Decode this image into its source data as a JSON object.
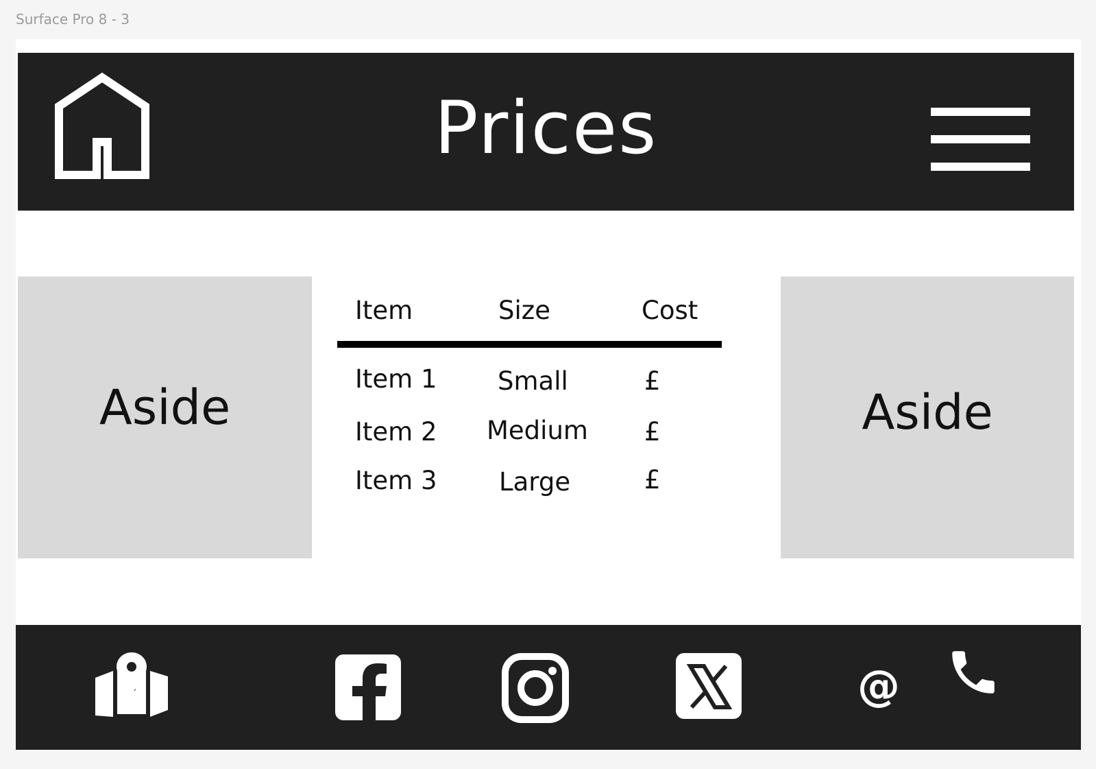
{
  "frame_label": "Surface Pro 8 - 3",
  "colors": {
    "header_bg": "#202020",
    "footer_bg": "#202020",
    "aside_bg": "#d9d9d9",
    "page_bg": "#ffffff",
    "canvas_bg": "#f5f5f5"
  },
  "header": {
    "title": "Prices",
    "home_icon": "home-icon",
    "menu_icon": "hamburger-menu-icon"
  },
  "aside_left": {
    "label": "Aside"
  },
  "aside_right": {
    "label": "Aside"
  },
  "price_table": {
    "columns": [
      "Item",
      "Size",
      "Cost"
    ],
    "rows": [
      [
        "Item 1",
        "Small",
        "£"
      ],
      [
        "Item 2",
        "Medium",
        "£"
      ],
      [
        "Item 3",
        "Large",
        "£"
      ]
    ]
  },
  "footer": {
    "icons": [
      "map-pin-icon",
      "facebook-icon",
      "instagram-icon",
      "x-icon",
      "at-sign-icon",
      "phone-icon"
    ],
    "email_symbol": "@"
  }
}
